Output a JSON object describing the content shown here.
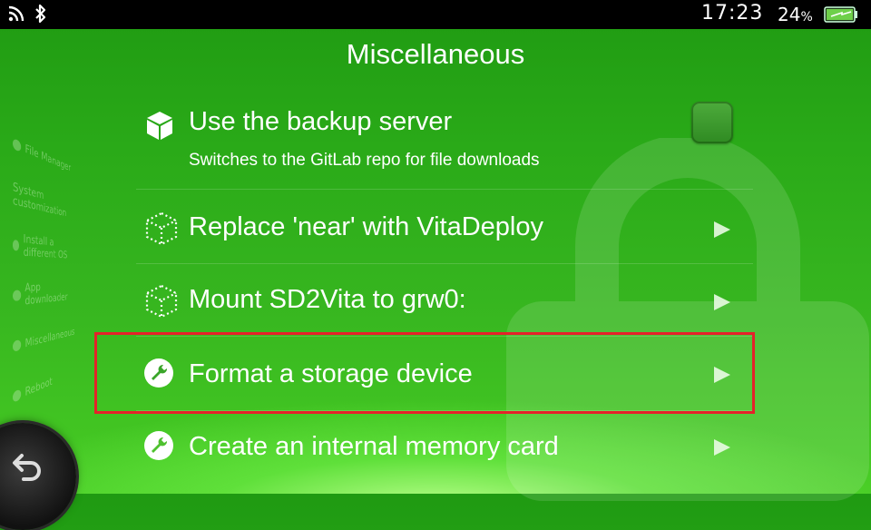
{
  "status_bar": {
    "icons": [
      "wifi-icon",
      "bluetooth-icon"
    ],
    "time": "17:23",
    "battery_percent": "24",
    "battery_unit": "%"
  },
  "side_menu": {
    "items": [
      "File Manager",
      "System customization",
      "Install a different OS",
      "App downloader",
      "Miscellaneous",
      "Reboot"
    ]
  },
  "page": {
    "title": "Miscellaneous"
  },
  "options": [
    {
      "label": "Use the backup server",
      "description": "Switches to the GitLab repo for file downloads",
      "icon": "cube-icon",
      "control": "checkbox"
    },
    {
      "label": "Replace 'near' with VitaDeploy",
      "icon": "dotted-cube-icon",
      "control": "arrow"
    },
    {
      "label": "Mount SD2Vita to grw0:",
      "icon": "dotted-cube-icon",
      "control": "arrow"
    },
    {
      "label": "Format a storage device",
      "icon": "wrench-icon",
      "control": "arrow",
      "highlighted": true
    },
    {
      "label": "Create an internal memory card",
      "icon": "wrench-icon",
      "control": "arrow"
    }
  ],
  "colors": {
    "background_green": "#2aaa18",
    "highlight_red": "#e5222a",
    "status_bar": "#000000"
  }
}
